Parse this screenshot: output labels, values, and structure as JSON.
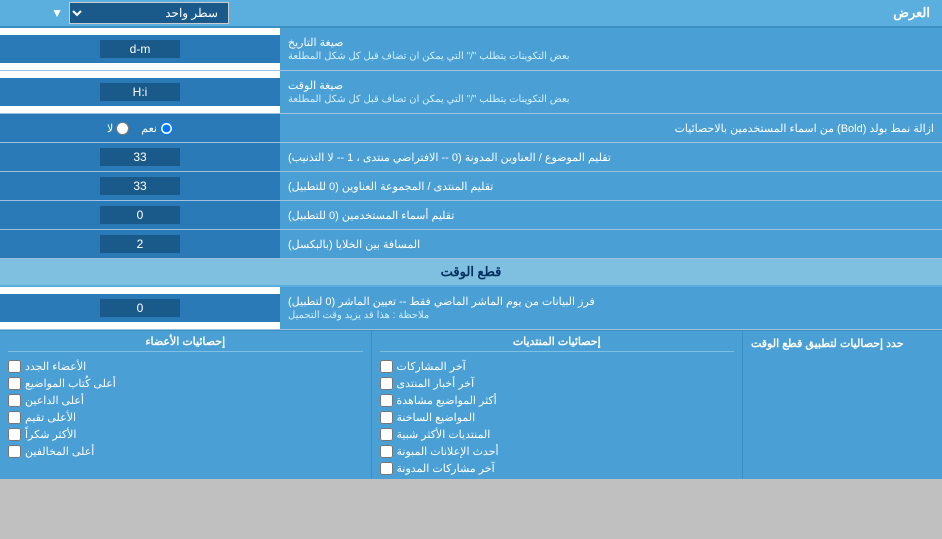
{
  "page": {
    "title": "العرض",
    "header_select_label": "سطر واحد",
    "sections": [
      {
        "id": "date_format",
        "label": "صيغة التاريخ",
        "sub_label": "بعض التكوينات يتطلب \"/\" التي يمكن ان تضاف قبل كل شكل المطلعة",
        "value": "d-m",
        "type": "text"
      },
      {
        "id": "time_format",
        "label": "صيغة الوقت",
        "sub_label": "بعض التكوينات يتطلب \"/\" التي يمكن ان تضاف قبل كل شكل المطلعة",
        "value": "H:i",
        "type": "text"
      },
      {
        "id": "bold_remove",
        "label": "ازالة نمط بولد (Bold) من اسماء المستخدمين بالاحصائيات",
        "type": "radio",
        "options": [
          {
            "label": "نعم",
            "value": "yes",
            "checked": true
          },
          {
            "label": "لا",
            "value": "no",
            "checked": false
          }
        ]
      },
      {
        "id": "topic_titles_count",
        "label": "تقليم الموضوع / العناوين المدونة (0 -- الافتراضي منتدى ، 1 -- لا التذنيب)",
        "value": "33",
        "type": "text"
      },
      {
        "id": "forum_titles_count",
        "label": "تقليم المنتدى / المجموعة العناوين (0 للتطبيل)",
        "value": "33",
        "type": "text"
      },
      {
        "id": "usernames_count",
        "label": "تقليم أسماء المستخدمين (0 للتطبيل)",
        "value": "0",
        "type": "text"
      },
      {
        "id": "cell_spacing",
        "label": "المسافة بين الخلايا (بالبكسل)",
        "value": "2",
        "type": "text"
      }
    ],
    "time_cut_section": {
      "header": "قطع الوقت",
      "field": {
        "id": "time_cut_days",
        "value": "0",
        "label": "فرز البيانات من يوم الماشر الماضي فقط -- تعيين الماشر (0 لتطبيل)",
        "note": "ملاحظة : هذا قد يزيد وقت التحميل",
        "type": "text"
      }
    },
    "stats_section": {
      "limit_label": "حدد إحصاليات لتطبيق قطع الوقت",
      "columns": [
        {
          "id": "col_empty",
          "header": "",
          "items": []
        },
        {
          "id": "col_post_stats",
          "header": "إحصائيات المنتديات",
          "items": [
            {
              "label": "آخر المشاركات",
              "id": "last_posts"
            },
            {
              "label": "آخر أخبار المنتدى",
              "id": "last_forum_news"
            },
            {
              "label": "أكثر المواضيع مشاهدة",
              "id": "most_viewed"
            },
            {
              "label": "المواضيع الساخنة",
              "id": "hot_topics"
            },
            {
              "label": "المنتديات الأكثر شبية",
              "id": "most_similar_forums"
            },
            {
              "label": "أحدث الإعلانات المبونة",
              "id": "latest_ads"
            },
            {
              "label": "آخر مشاركات المدونة",
              "id": "last_blog_posts"
            }
          ]
        },
        {
          "id": "col_member_stats",
          "header": "إحصائيات الأعضاء",
          "items": [
            {
              "label": "الأعضاء الجدد",
              "id": "new_members"
            },
            {
              "label": "أعلى كُتاب المواضيع",
              "id": "top_writers"
            },
            {
              "label": "أعلى الداعين",
              "id": "top_posters"
            },
            {
              "label": "الأعلى تقيم",
              "id": "top_rated"
            },
            {
              "label": "الأكثر شكراً",
              "id": "most_thanked"
            },
            {
              "label": "أعلى المخالفين",
              "id": "top_violators"
            }
          ]
        }
      ]
    }
  }
}
